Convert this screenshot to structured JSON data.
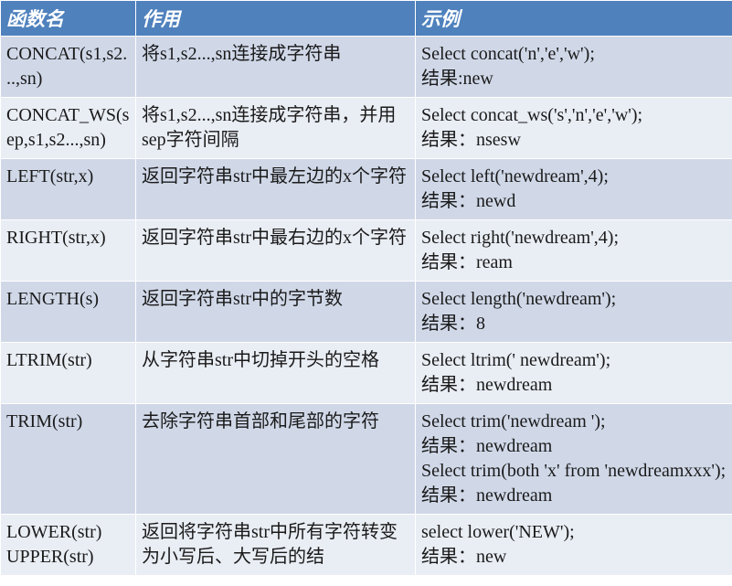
{
  "headers": {
    "col1": "函数名",
    "col2": "作用",
    "col3": "示例"
  },
  "rows": [
    {
      "name": "CONCAT(s1,s2...,sn)",
      "desc": "将s1,s2...,sn连接成字符串",
      "example": "Select concat('n','e','w');\n结果:new"
    },
    {
      "name": "CONCAT_WS(sep,s1,s2...,sn)",
      "desc": "将s1,s2...,sn连接成字符串，并用sep字符间隔",
      "example": "Select concat_ws('s','n','e','w');\n结果：nsesw"
    },
    {
      "name": "LEFT(str,x)",
      "desc": "返回字符串str中最左边的x个字符",
      "example": "Select left('newdream',4);\n结果：newd"
    },
    {
      "name": "RIGHT(str,x)",
      "desc": "返回字符串str中最右边的x个字符",
      "example": "Select  right('newdream',4);\n结果：ream"
    },
    {
      "name": "LENGTH(s)",
      "desc": "返回字符串str中的字节数",
      "example": "Select length('newdream');\n结果：8"
    },
    {
      "name": "LTRIM(str)",
      "desc": "从字符串str中切掉开头的空格",
      "example": "Select ltrim('   newdream');\n结果：newdream"
    },
    {
      "name": "TRIM(str)",
      "desc": "去除字符串首部和尾部的字符",
      "example": "Select  trim('newdream   ');\n结果：newdream\nSelect  trim(both 'x' from 'newdreamxxx');\n结果：newdream"
    },
    {
      "name": "LOWER(str)\nUPPER(str)",
      "desc": "返回将字符串str中所有字符转变为小写后、大写后的结",
      "example": "select lower('NEW');\n结果：new"
    }
  ]
}
